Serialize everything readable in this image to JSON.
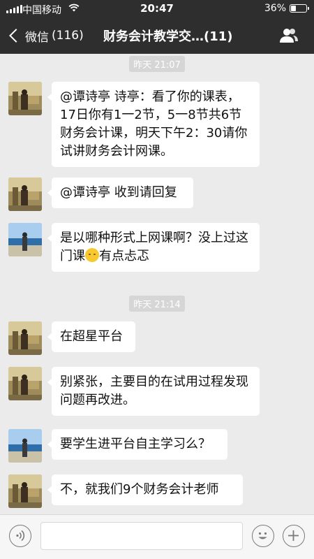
{
  "status": {
    "carrier": "中国移动",
    "time": "20:47",
    "battery_pct": "36%"
  },
  "nav": {
    "back_label": "微信",
    "back_count": "(116)",
    "title": "财务会计教学交…(11)"
  },
  "chat": {
    "timestamps": [
      "昨天 21:07",
      "昨天 21:14"
    ],
    "messages": [
      {
        "text": "@谭诗亭 诗亭：看了你的课表，17日你有1一2节，5一8节共6节财务会计课，明天下午2：30请你试讲财务会计网课。"
      },
      {
        "text": "@谭诗亭 收到请回复"
      },
      {
        "text_before": "是以哪种形式上网课啊？没上过这门课",
        "emoji": "sleepy-sweat-emoji",
        "text_after": "有点忐忑"
      },
      {
        "text": "在超星平台"
      },
      {
        "text": "别紧张，主要目的在试用过程发现问题再改进。"
      },
      {
        "text": "要学生进平台自主学习么？"
      },
      {
        "text": "不，就我们9个财务会计老师"
      }
    ]
  },
  "input": {
    "placeholder": ""
  },
  "colors": {
    "nav_bg": "#2e2e2e",
    "chat_bg": "#ebebeb",
    "bubble_bg": "#ffffff"
  }
}
